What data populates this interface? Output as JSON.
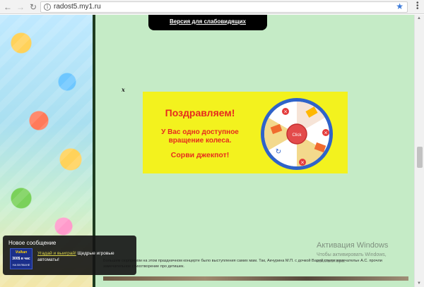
{
  "browser": {
    "url": "radost5.my1.ru",
    "icons": [
      "back-arrow-icon",
      "forward-arrow-icon",
      "reload-icon",
      "info-icon",
      "star-icon",
      "menu-icon"
    ]
  },
  "page": {
    "accessibility_label": "Версия для слабовидящих",
    "close_mark": "x",
    "banner": {
      "title": "Поздравляем!",
      "line1": "У Вас одно доступное",
      "line2": "вращение колеса.",
      "jackpot": "Сорви джекпот!",
      "wheel_button": "Click",
      "colors": {
        "background": "#f3f21e",
        "text": "#e62b1e"
      }
    },
    "article": "Большим сюрпризом на этом праздничном концерте было выступления самих мам. Так, Акчурина М.П. с дочкой Варей спели замечательн А.С. прочли замечательное стихотворение про детишек."
  },
  "notification": {
    "title": "Новое сообщение",
    "link": "Угадай и выиграй!",
    "text": " Щедрые игровые автоматы!",
    "logo_top": "Vulkan",
    "logo_mid": "300$ в час",
    "logo_bot": "НА ВУЛКАНЕ"
  },
  "watermark": {
    "title": "Активация Windows",
    "line1": "Чтобы активировать Windows,",
    "line2": "компьютера."
  }
}
